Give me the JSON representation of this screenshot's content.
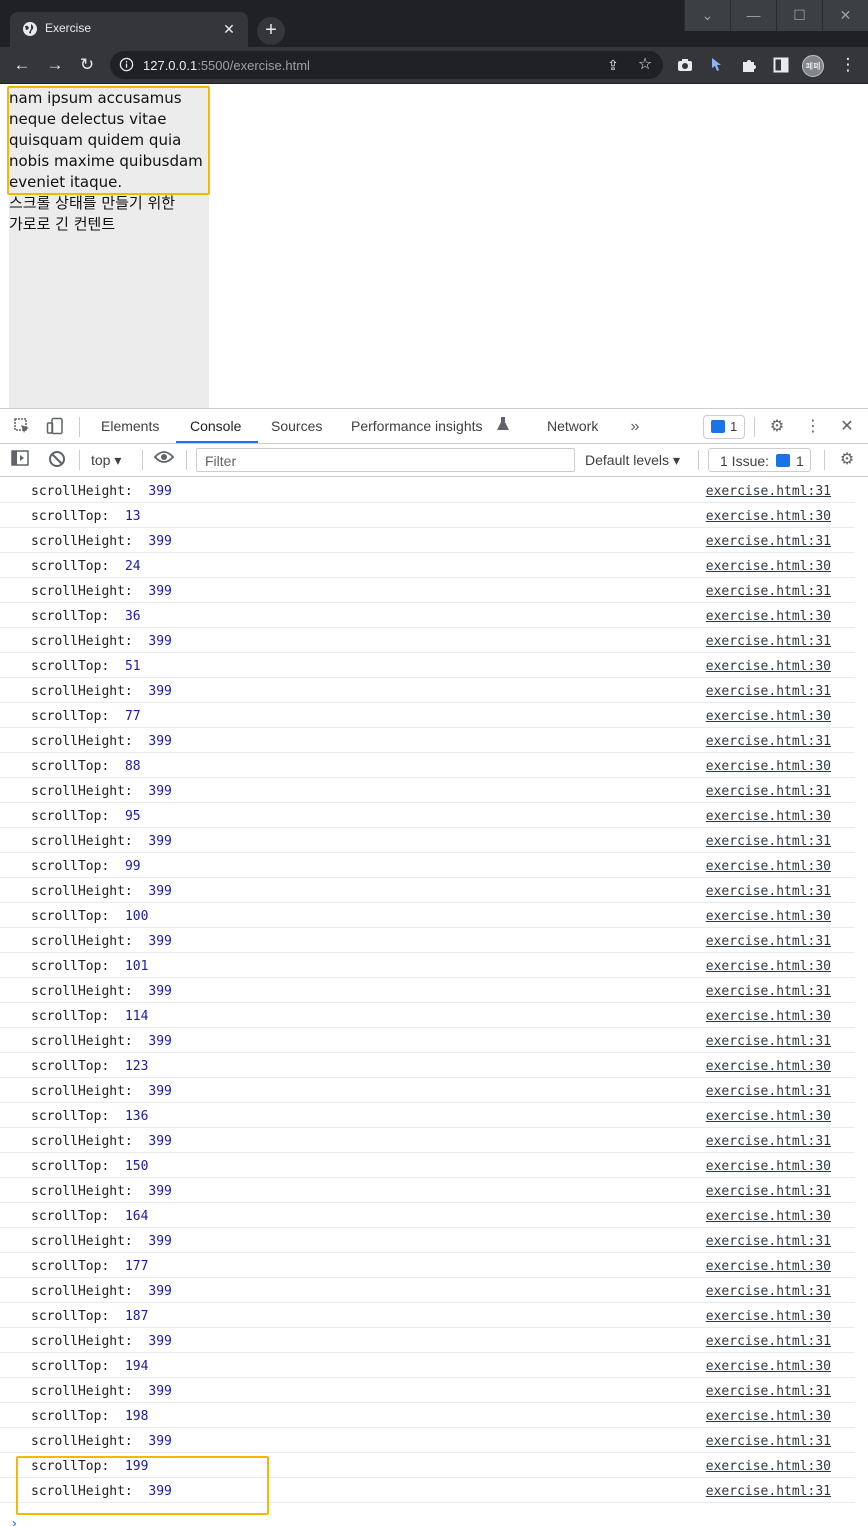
{
  "browser": {
    "tab_title": "Exercise",
    "url_host": "127.0.0.1",
    "url_rest": ":5500/exercise.html",
    "avatar_text": "폐폐"
  },
  "page": {
    "lines": [
      "nam ipsum accusamus",
      "neque delectus vitae",
      "quisquam quidem quia",
      "nobis maxime quibusdam",
      "eveniet itaque.",
      "스크롤 상태를 만들기 위한",
      "가로로 긴 컨텐트"
    ]
  },
  "devtools": {
    "tabs": [
      {
        "label": "Elements"
      },
      {
        "label": "Console"
      },
      {
        "label": "Sources"
      },
      {
        "label": "Performance insights"
      },
      {
        "label": "Network"
      }
    ],
    "issue_badge_count": "1",
    "context": "top",
    "filter_placeholder": "Filter",
    "levels": "Default levels",
    "issues_label": "1 Issue:",
    "issues_count": "1"
  },
  "console": {
    "rows": [
      {
        "label": "scrollHeight:",
        "value": "399",
        "source": "exercise.html:31"
      },
      {
        "label": "scrollTop:",
        "value": "13",
        "source": "exercise.html:30"
      },
      {
        "label": "scrollHeight:",
        "value": "399",
        "source": "exercise.html:31"
      },
      {
        "label": "scrollTop:",
        "value": "24",
        "source": "exercise.html:30"
      },
      {
        "label": "scrollHeight:",
        "value": "399",
        "source": "exercise.html:31"
      },
      {
        "label": "scrollTop:",
        "value": "36",
        "source": "exercise.html:30"
      },
      {
        "label": "scrollHeight:",
        "value": "399",
        "source": "exercise.html:31"
      },
      {
        "label": "scrollTop:",
        "value": "51",
        "source": "exercise.html:30"
      },
      {
        "label": "scrollHeight:",
        "value": "399",
        "source": "exercise.html:31"
      },
      {
        "label": "scrollTop:",
        "value": "77",
        "source": "exercise.html:30"
      },
      {
        "label": "scrollHeight:",
        "value": "399",
        "source": "exercise.html:31"
      },
      {
        "label": "scrollTop:",
        "value": "88",
        "source": "exercise.html:30"
      },
      {
        "label": "scrollHeight:",
        "value": "399",
        "source": "exercise.html:31"
      },
      {
        "label": "scrollTop:",
        "value": "95",
        "source": "exercise.html:30"
      },
      {
        "label": "scrollHeight:",
        "value": "399",
        "source": "exercise.html:31"
      },
      {
        "label": "scrollTop:",
        "value": "99",
        "source": "exercise.html:30"
      },
      {
        "label": "scrollHeight:",
        "value": "399",
        "source": "exercise.html:31"
      },
      {
        "label": "scrollTop:",
        "value": "100",
        "source": "exercise.html:30"
      },
      {
        "label": "scrollHeight:",
        "value": "399",
        "source": "exercise.html:31"
      },
      {
        "label": "scrollTop:",
        "value": "101",
        "source": "exercise.html:30"
      },
      {
        "label": "scrollHeight:",
        "value": "399",
        "source": "exercise.html:31"
      },
      {
        "label": "scrollTop:",
        "value": "114",
        "source": "exercise.html:30"
      },
      {
        "label": "scrollHeight:",
        "value": "399",
        "source": "exercise.html:31"
      },
      {
        "label": "scrollTop:",
        "value": "123",
        "source": "exercise.html:30"
      },
      {
        "label": "scrollHeight:",
        "value": "399",
        "source": "exercise.html:31"
      },
      {
        "label": "scrollTop:",
        "value": "136",
        "source": "exercise.html:30"
      },
      {
        "label": "scrollHeight:",
        "value": "399",
        "source": "exercise.html:31"
      },
      {
        "label": "scrollTop:",
        "value": "150",
        "source": "exercise.html:30"
      },
      {
        "label": "scrollHeight:",
        "value": "399",
        "source": "exercise.html:31"
      },
      {
        "label": "scrollTop:",
        "value": "164",
        "source": "exercise.html:30"
      },
      {
        "label": "scrollHeight:",
        "value": "399",
        "source": "exercise.html:31"
      },
      {
        "label": "scrollTop:",
        "value": "177",
        "source": "exercise.html:30"
      },
      {
        "label": "scrollHeight:",
        "value": "399",
        "source": "exercise.html:31"
      },
      {
        "label": "scrollTop:",
        "value": "187",
        "source": "exercise.html:30"
      },
      {
        "label": "scrollHeight:",
        "value": "399",
        "source": "exercise.html:31"
      },
      {
        "label": "scrollTop:",
        "value": "194",
        "source": "exercise.html:30"
      },
      {
        "label": "scrollHeight:",
        "value": "399",
        "source": "exercise.html:31"
      },
      {
        "label": "scrollTop:",
        "value": "198",
        "source": "exercise.html:30"
      },
      {
        "label": "scrollHeight:",
        "value": "399",
        "source": "exercise.html:31"
      },
      {
        "label": "scrollTop:",
        "value": "199",
        "source": "exercise.html:30"
      },
      {
        "label": "scrollHeight:",
        "value": "399",
        "source": "exercise.html:31"
      }
    ]
  },
  "colors": {
    "highlight": "#f5b800",
    "accent": "#1a73e8",
    "console_value": "#1a1aa6"
  }
}
